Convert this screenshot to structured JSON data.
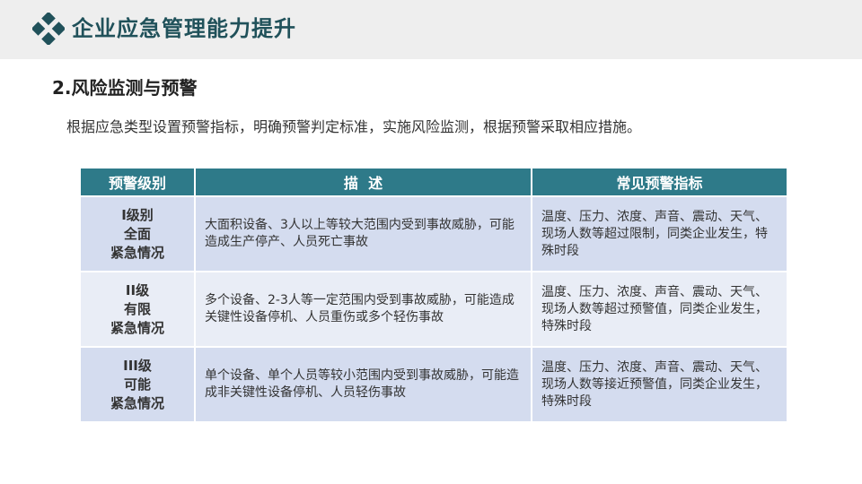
{
  "header": {
    "title": "企业应急管理能力提升",
    "logo_icon": "diamond-cluster-icon",
    "accent_color": "#20515a"
  },
  "section": {
    "title": "2.风险监测与预警",
    "intro": "根据应急类型设置预警指标，明确预警判定标准，实施风险监测，根据预警采取相应措施。"
  },
  "table": {
    "header_color": "#2e7a89",
    "headers": [
      "预警级别",
      "描  述",
      "常见预警指标"
    ],
    "rows": [
      {
        "level": [
          "I级别",
          "全面",
          "紧急情况"
        ],
        "description": "大面积设备、3人以上等较大范围内受到事故威胁，可能造成生产停产、人员死亡事故",
        "indicators": "温度、压力、浓度、声音、震动、天气、现场人数等超过限制，同类企业发生，特殊时段"
      },
      {
        "level": [
          "II级",
          "有限",
          "紧急情况"
        ],
        "description": "多个设备、2-3人等一定范围内受到事故威胁，可能造成关键性设备停机、人员重伤或多个轻伤事故",
        "indicators": "温度、压力、浓度、声音、震动、天气、现场人数等超过预警值，同类企业发生，特殊时段"
      },
      {
        "level": [
          "III级",
          "可能",
          "紧急情况"
        ],
        "description": "单个设备、单个人员等较小范围内受到事故威胁，可能造成非关键性设备停机、人员轻伤事故",
        "indicators": "温度、压力、浓度、声音、震动、天气、现场人数等接近预警值，同类企业发生，特殊时段"
      }
    ]
  }
}
